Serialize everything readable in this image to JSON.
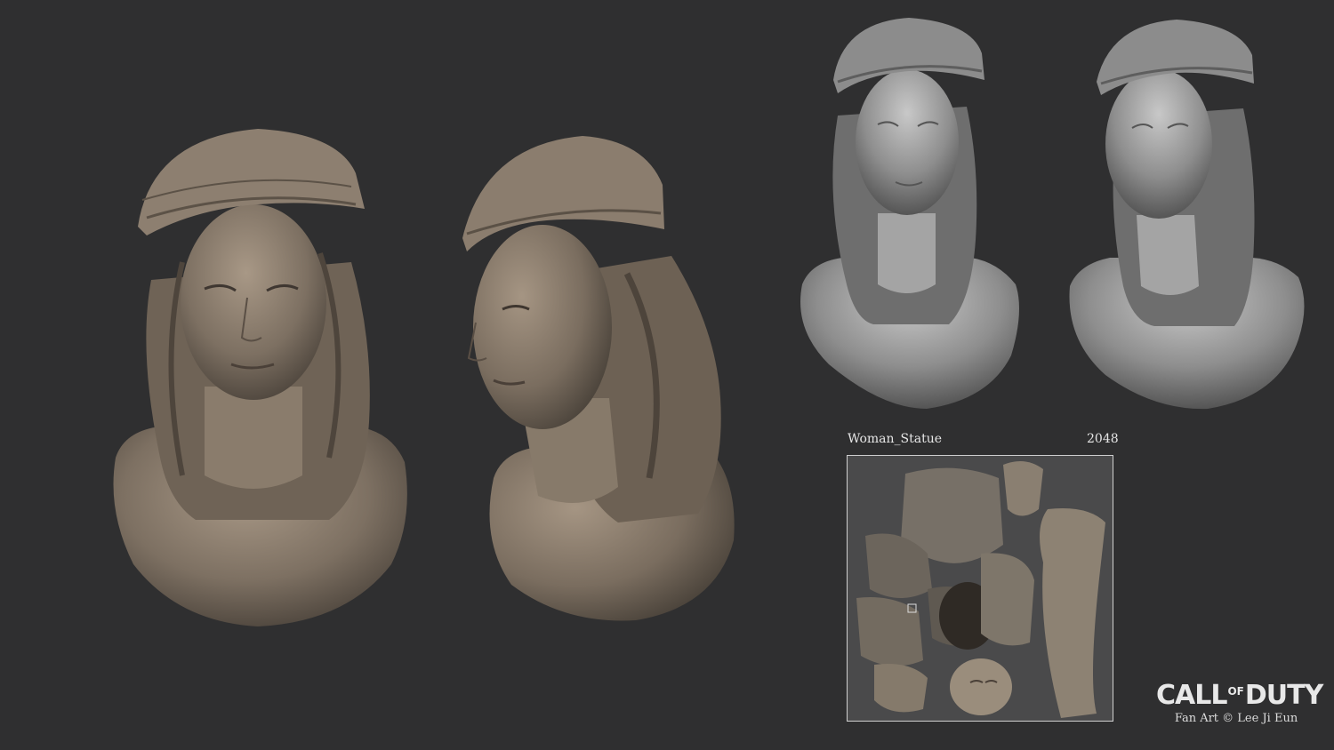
{
  "texture": {
    "name": "Woman_Statue",
    "resolution": "2048"
  },
  "branding": {
    "logo_call": "CALL",
    "logo_of": "OF",
    "logo_duty": "DUTY",
    "credit": "Fan Art © Lee Ji Eun"
  },
  "colors": {
    "background": "#2f2f30",
    "stone": "#8b7d6e",
    "clay": "#9a9a9a"
  }
}
